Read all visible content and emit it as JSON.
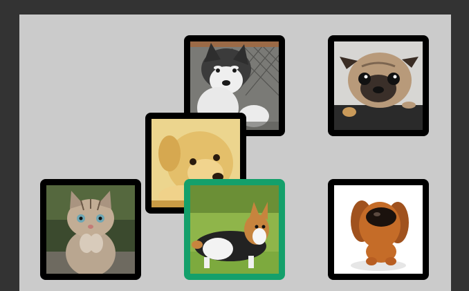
{
  "board": {
    "background": "#cbcbcb",
    "frame_color": "#000000",
    "selected_color": "#14a06b"
  },
  "tiles": [
    {
      "name": "husky-puppy",
      "icon": "husky-puppy-photo",
      "selected": false
    },
    {
      "name": "pug",
      "icon": "pug-photo",
      "selected": false
    },
    {
      "name": "golden-puppy",
      "icon": "golden-puppy-photo",
      "selected": false
    },
    {
      "name": "kitten",
      "icon": "kitten-photo",
      "selected": false
    },
    {
      "name": "corgi",
      "icon": "corgi-photo",
      "selected": true
    },
    {
      "name": "dachshund",
      "icon": "dachshund-photo",
      "selected": false
    }
  ]
}
